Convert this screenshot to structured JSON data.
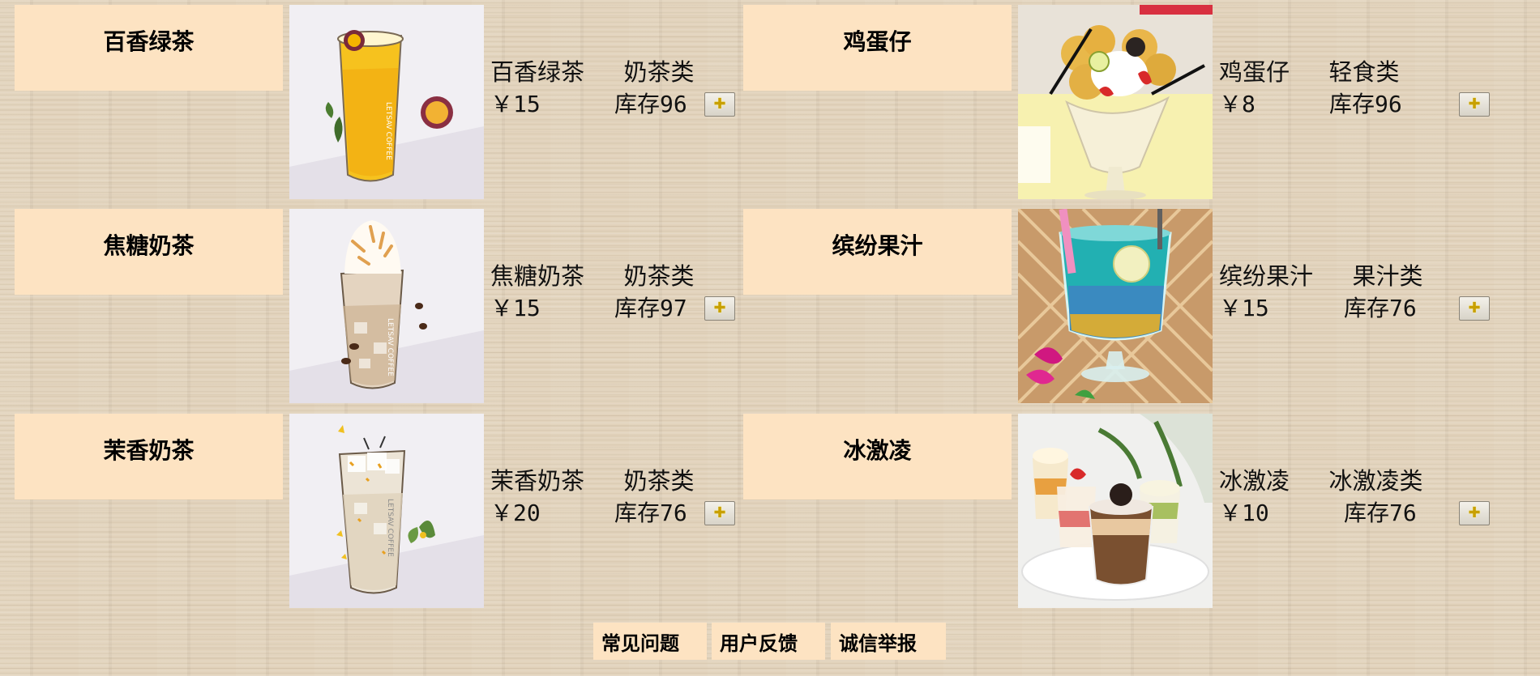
{
  "products": [
    {
      "name": "百香绿茶",
      "info_name": "百香绿茶",
      "category": "奶茶类",
      "price": "￥15",
      "stock": "库存96",
      "image": "passion-green-tea-photo"
    },
    {
      "name": "鸡蛋仔",
      "info_name": "鸡蛋仔",
      "category": "轻食类",
      "price": "￥8",
      "stock": "库存96",
      "image": "egg-waffle-photo"
    },
    {
      "name": "焦糖奶茶",
      "info_name": "焦糖奶茶",
      "category": "奶茶类",
      "price": "￥15",
      "stock": "库存97",
      "image": "caramel-milk-tea-photo"
    },
    {
      "name": "缤纷果汁",
      "info_name": "缤纷果汁",
      "category": "果汁类",
      "price": "￥15",
      "stock": "库存76",
      "image": "mixed-juice-photo"
    },
    {
      "name": "茉香奶茶",
      "info_name": "茉香奶茶",
      "category": "奶茶类",
      "price": "￥20",
      "stock": "库存76",
      "image": "jasmine-milk-tea-photo"
    },
    {
      "name": "冰激凌",
      "info_name": "冰激凌",
      "category": "冰激凌类",
      "price": "￥10",
      "stock": "库存76",
      "image": "ice-cream-photo"
    }
  ],
  "add_button_icon": "add-cart-icon",
  "footer": {
    "faq": "常见问题",
    "feedback": "用户反馈",
    "report": "诚信举报"
  },
  "colors": {
    "label_bg": "#fde3c2",
    "page_bg": "#e2d3bc"
  }
}
